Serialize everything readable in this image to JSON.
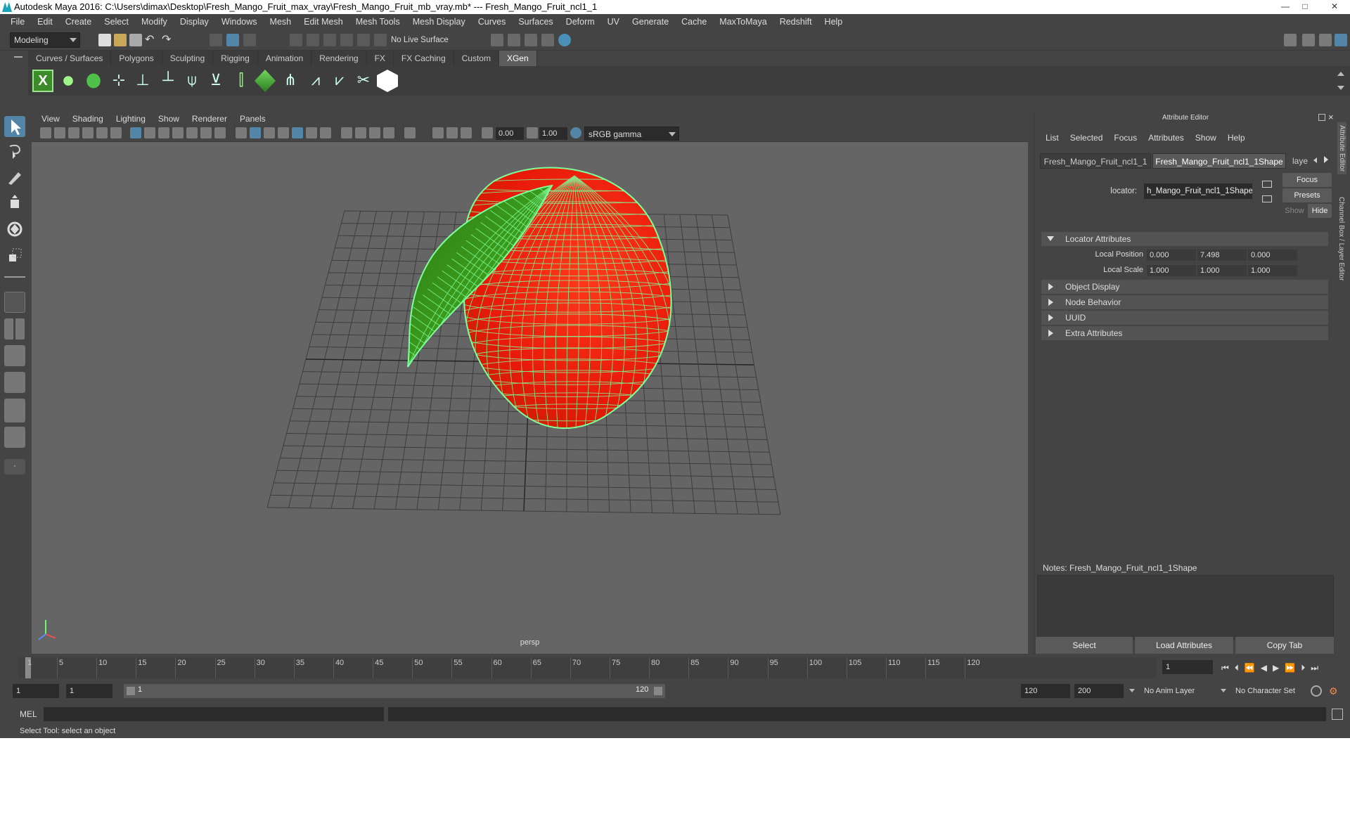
{
  "window": {
    "title": "Autodesk Maya 2016: C:\\Users\\dimax\\Desktop\\Fresh_Mango_Fruit_max_vray\\Fresh_Mango_Fruit_mb_vray.mb*   ---   Fresh_Mango_Fruit_ncl1_1",
    "minimize": "—",
    "maximize": "□",
    "close": "✕"
  },
  "menubar": [
    "File",
    "Edit",
    "Create",
    "Select",
    "Modify",
    "Display",
    "Windows",
    "Mesh",
    "Edit Mesh",
    "Mesh Tools",
    "Mesh Display",
    "Curves",
    "Surfaces",
    "Deform",
    "UV",
    "Generate",
    "Cache",
    "MaxToMaya",
    "Redshift",
    "Help"
  ],
  "statusline": {
    "mode": "Modeling",
    "live_surface": "No Live Surface"
  },
  "shelf_tabs": [
    "Curves / Surfaces",
    "Polygons",
    "Sculpting",
    "Rigging",
    "Animation",
    "Rendering",
    "FX",
    "FX Caching",
    "Custom",
    "XGen"
  ],
  "shelf_active": "XGen",
  "viewport": {
    "menu": [
      "View",
      "Shading",
      "Lighting",
      "Show",
      "Renderer",
      "Panels"
    ],
    "exposure": "0.00",
    "gamma": "1.00",
    "color_space": "sRGB gamma",
    "camera_label": "persp"
  },
  "attribute_editor": {
    "title": "Attribute Editor",
    "menu": [
      "List",
      "Selected",
      "Focus",
      "Attributes",
      "Show",
      "Help"
    ],
    "tabs": [
      "Fresh_Mango_Fruit_ncl1_1",
      "Fresh_Mango_Fruit_ncl1_1Shape",
      "laye"
    ],
    "node_type_label": "locator:",
    "node_name": "h_Mango_Fruit_ncl1_1Shape",
    "focus_btn": "Focus",
    "presets_btn": "Presets",
    "show_btn": "Show",
    "hide_btn": "Hide",
    "sections": {
      "locator": "Locator Attributes",
      "object_display": "Object Display",
      "node_behavior": "Node Behavior",
      "uuid": "UUID",
      "extra": "Extra Attributes"
    },
    "local_position": {
      "label": "Local Position",
      "x": "0.000",
      "y": "7.498",
      "z": "0.000"
    },
    "local_scale": {
      "label": "Local Scale",
      "x": "1.000",
      "y": "1.000",
      "z": "1.000"
    },
    "notes_label": "Notes:  Fresh_Mango_Fruit_ncl1_1Shape",
    "select_btn": "Select",
    "load_btn": "Load Attributes",
    "copy_btn": "Copy Tab"
  },
  "right_strip": [
    "Attribute Editor",
    "Channel Box / Layer Editor"
  ],
  "timeline": {
    "ticks": [
      "1",
      "5",
      "10",
      "15",
      "20",
      "25",
      "30",
      "35",
      "40",
      "45",
      "50",
      "55",
      "60",
      "65",
      "70",
      "75",
      "80",
      "85",
      "90",
      "95",
      "100",
      "105",
      "110",
      "115",
      "120"
    ],
    "current_frame": "1"
  },
  "range": {
    "start": "1",
    "inner_start": "1",
    "slider_start": "1",
    "slider_end": "120",
    "end": "120",
    "max_end": "200",
    "anim_layer": "No Anim Layer",
    "char_set": "No Character Set"
  },
  "cmdline": {
    "label": "MEL"
  },
  "helpline": "Select Tool: select an object",
  "colors": {
    "mango": "#e8190a",
    "leaf": "#3a9a1c",
    "wire": "#7dff9a",
    "accent": "#5285a6"
  }
}
